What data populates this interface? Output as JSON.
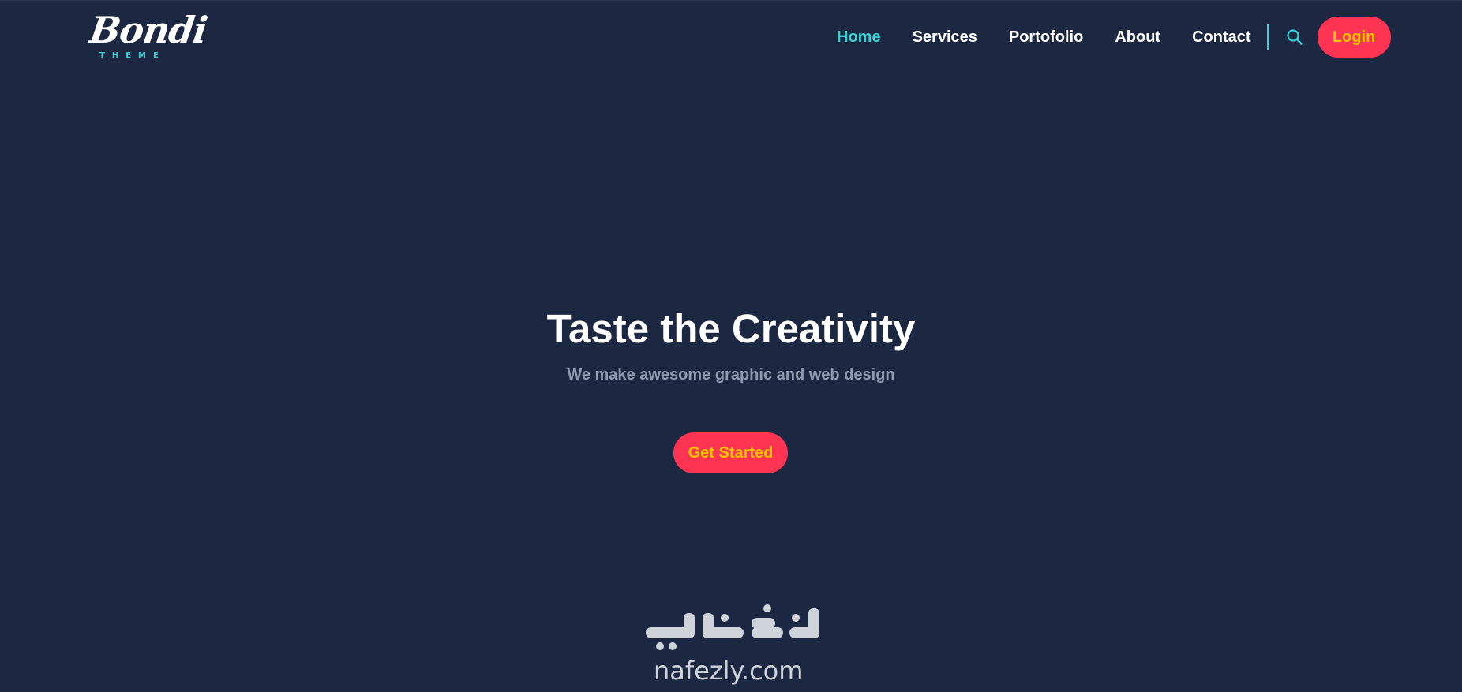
{
  "logo": {
    "script": "Bondi",
    "sub": "THEME"
  },
  "nav": {
    "items": [
      {
        "label": "Home",
        "active": true
      },
      {
        "label": "Services",
        "active": false
      },
      {
        "label": "Portofolio",
        "active": false
      },
      {
        "label": "About",
        "active": false
      },
      {
        "label": "Contact",
        "active": false
      }
    ],
    "login_label": "Login",
    "search_icon": "search-icon"
  },
  "hero": {
    "title": "Taste the Creativity",
    "subtitle": "We make awesome graphic and web design",
    "cta_label": "Get Started"
  },
  "watermark": {
    "arabic": "نفذلي",
    "latin": "nafezly.com"
  },
  "colors": {
    "background": "#1c2742",
    "accent": "#3ad1d6",
    "button_bg": "#ff3352",
    "button_text": "#f5c400",
    "subtitle": "#8f9ab0"
  }
}
